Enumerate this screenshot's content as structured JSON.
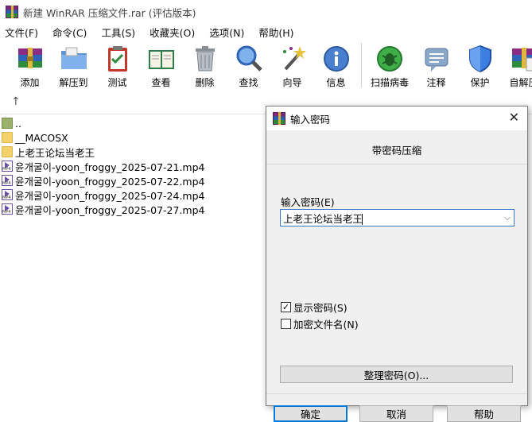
{
  "window": {
    "title": "新建 WinRAR 压缩文件.rar (评估版本)"
  },
  "menu": [
    "文件(F)",
    "命令(C)",
    "工具(S)",
    "收藏夹(O)",
    "选项(N)",
    "帮助(H)"
  ],
  "toolbar": [
    {
      "label": "添加",
      "icon": "add-archive-icon"
    },
    {
      "label": "解压到",
      "icon": "extract-folder-icon"
    },
    {
      "label": "测试",
      "icon": "test-clipboard-icon"
    },
    {
      "label": "查看",
      "icon": "view-book-icon"
    },
    {
      "label": "删除",
      "icon": "trash-icon"
    },
    {
      "label": "查找",
      "icon": "magnifier-icon"
    },
    {
      "label": "向导",
      "icon": "wizard-wand-icon"
    },
    {
      "label": "信息",
      "icon": "info-icon"
    },
    {
      "label": "扫描病毒",
      "icon": "virus-scan-icon"
    },
    {
      "label": "注释",
      "icon": "comment-icon"
    },
    {
      "label": "保护",
      "icon": "shield-icon"
    },
    {
      "label": "自解压",
      "icon": "sfx-archive-icon"
    }
  ],
  "up_icon": "up-arrow-icon",
  "up_glyph": "↑",
  "files": [
    {
      "name": "..",
      "type": "up"
    },
    {
      "name": "__MACOSX",
      "type": "folder"
    },
    {
      "name": "上老王论坛当老王",
      "type": "folder"
    },
    {
      "name": "윤개굴이-yoon_froggy_2025-07-21.mp4",
      "type": "mp4"
    },
    {
      "name": "윤개굴이-yoon_froggy_2025-07-22.mp4",
      "type": "mp4"
    },
    {
      "name": "윤개굴이-yoon_froggy_2025-07-24.mp4",
      "type": "mp4"
    },
    {
      "name": "윤개굴이-yoon_froggy_2025-07-27.mp4",
      "type": "mp4"
    }
  ],
  "dialog": {
    "title": "输入密码",
    "close_glyph": "✕",
    "subtitle": "带密码压缩",
    "password_label": "输入密码(E)",
    "password_value": "上老王论坛当老王",
    "dropdown_glyph": "⌵",
    "show_password": {
      "label": "显示密码(S)",
      "checked": true,
      "mark": "✓"
    },
    "encrypt_names": {
      "label": "加密文件名(N)",
      "checked": false
    },
    "organize_button": "整理密码(O)...",
    "ok_button": "确定",
    "cancel_button": "取消",
    "help_button": "帮助"
  }
}
